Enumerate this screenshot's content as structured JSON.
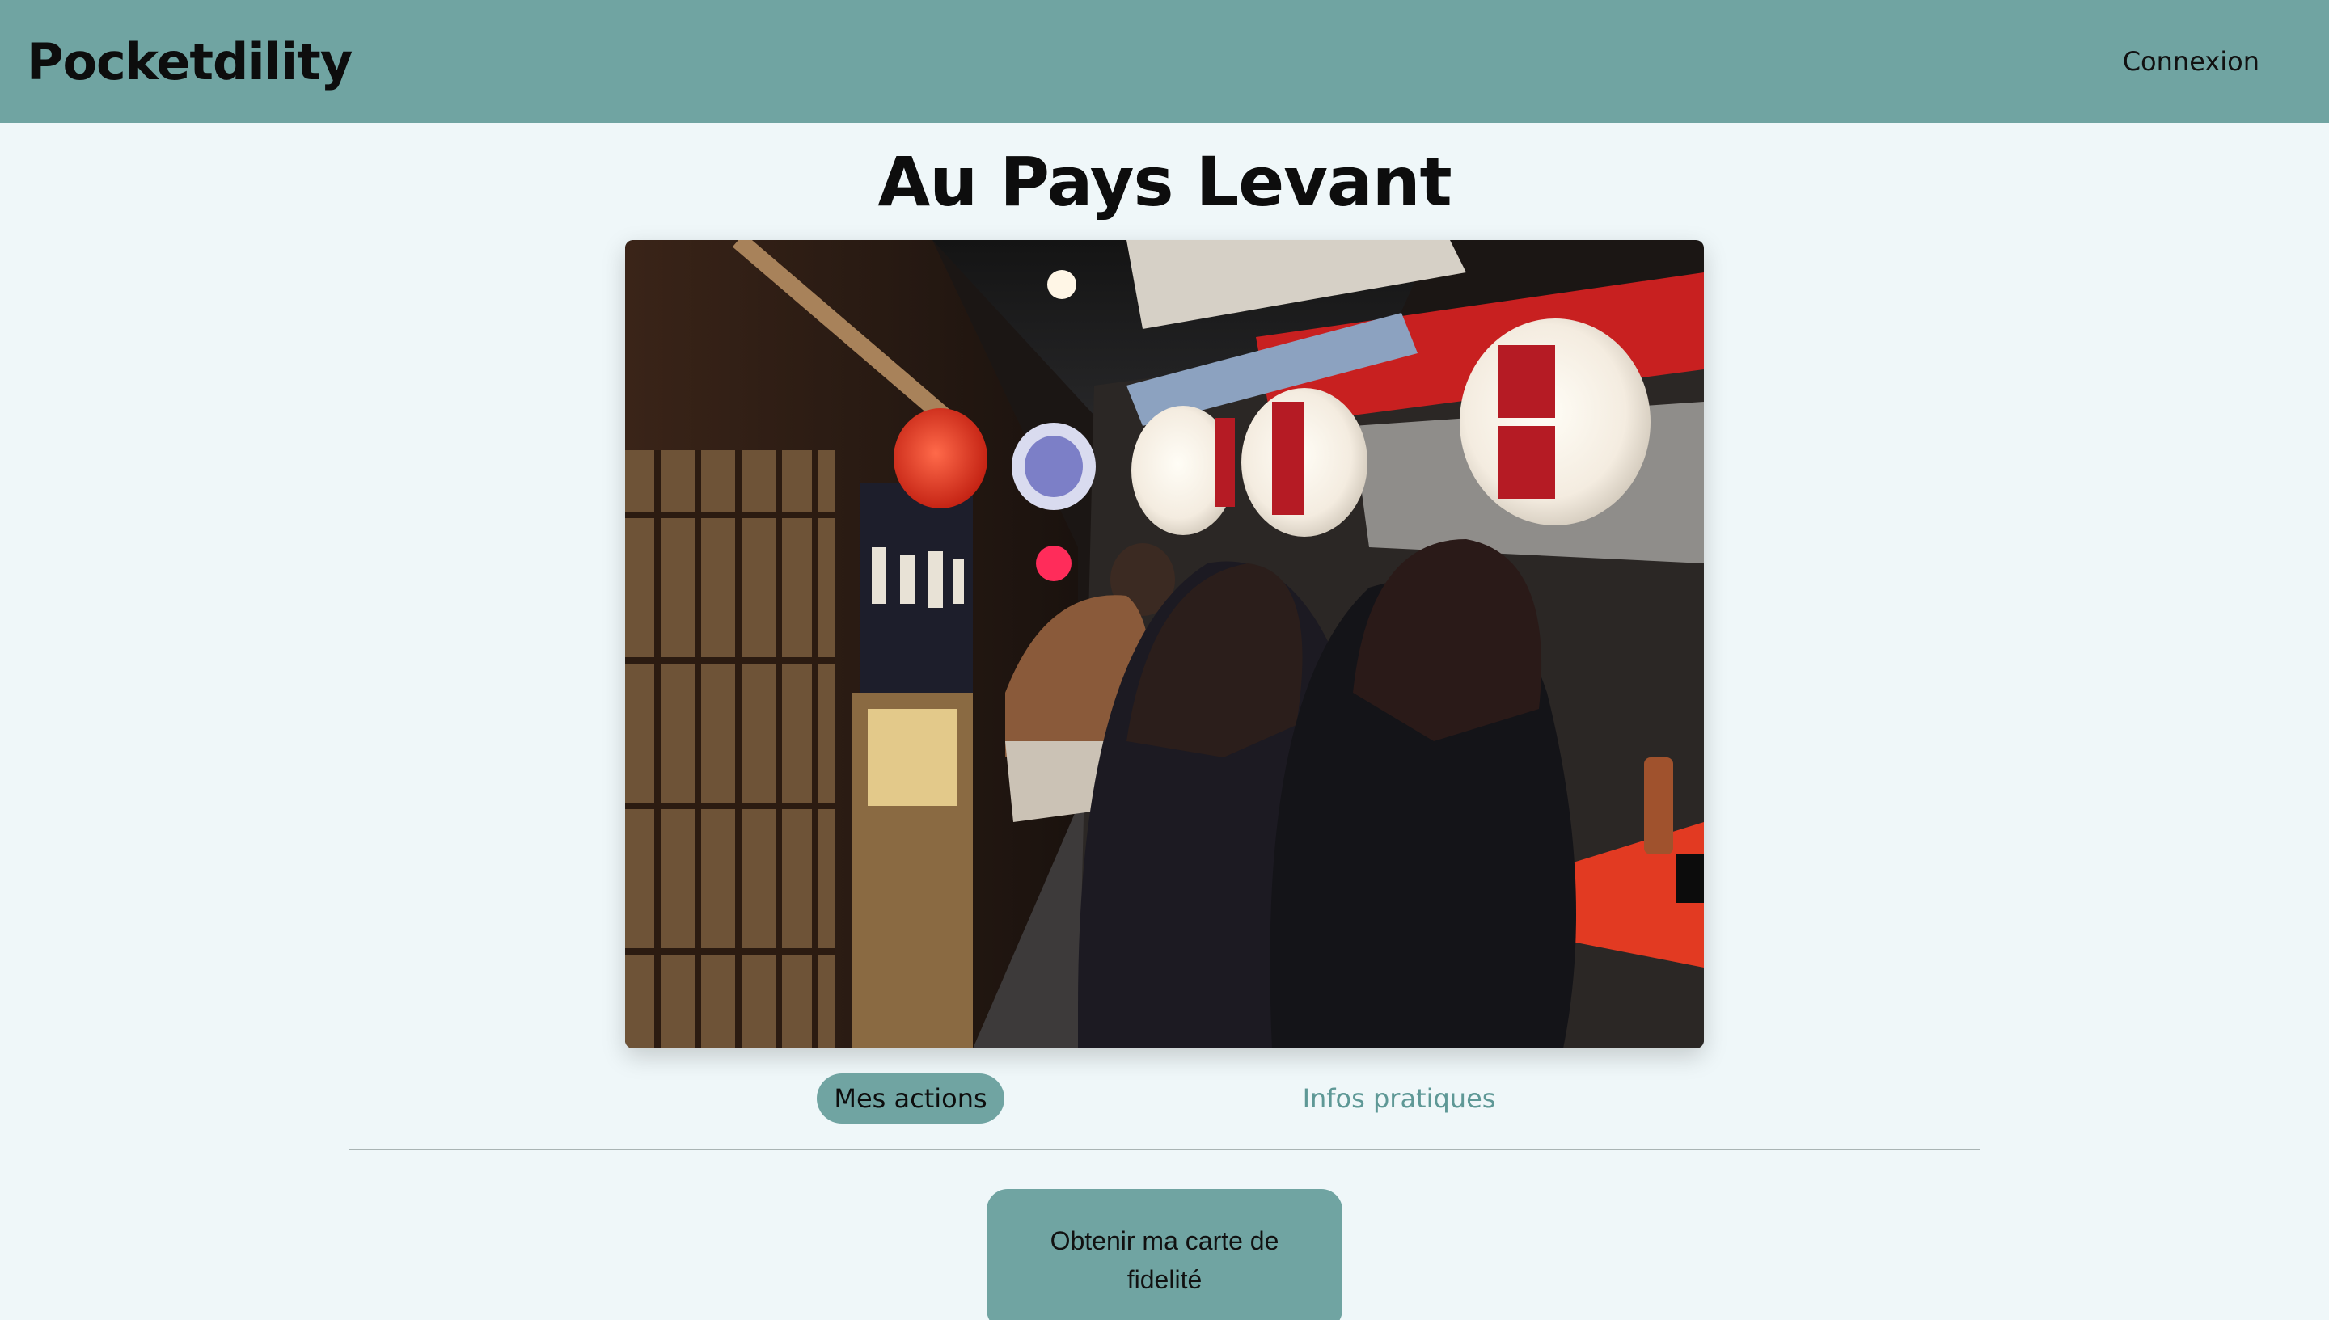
{
  "header": {
    "brand": "Pocketdility",
    "login_label": "Connexion"
  },
  "restaurant": {
    "name": "Au Pays Levant"
  },
  "tabs": [
    {
      "label": "Mes actions",
      "active": true
    },
    {
      "label": "Infos pratiques",
      "active": false
    }
  ],
  "cta": {
    "label": "Obtenir ma carte de fidelité"
  },
  "colors": {
    "header_bg": "#70a4a2",
    "page_bg": "#eff7f9",
    "inactive_tab_text": "#5e9896"
  }
}
